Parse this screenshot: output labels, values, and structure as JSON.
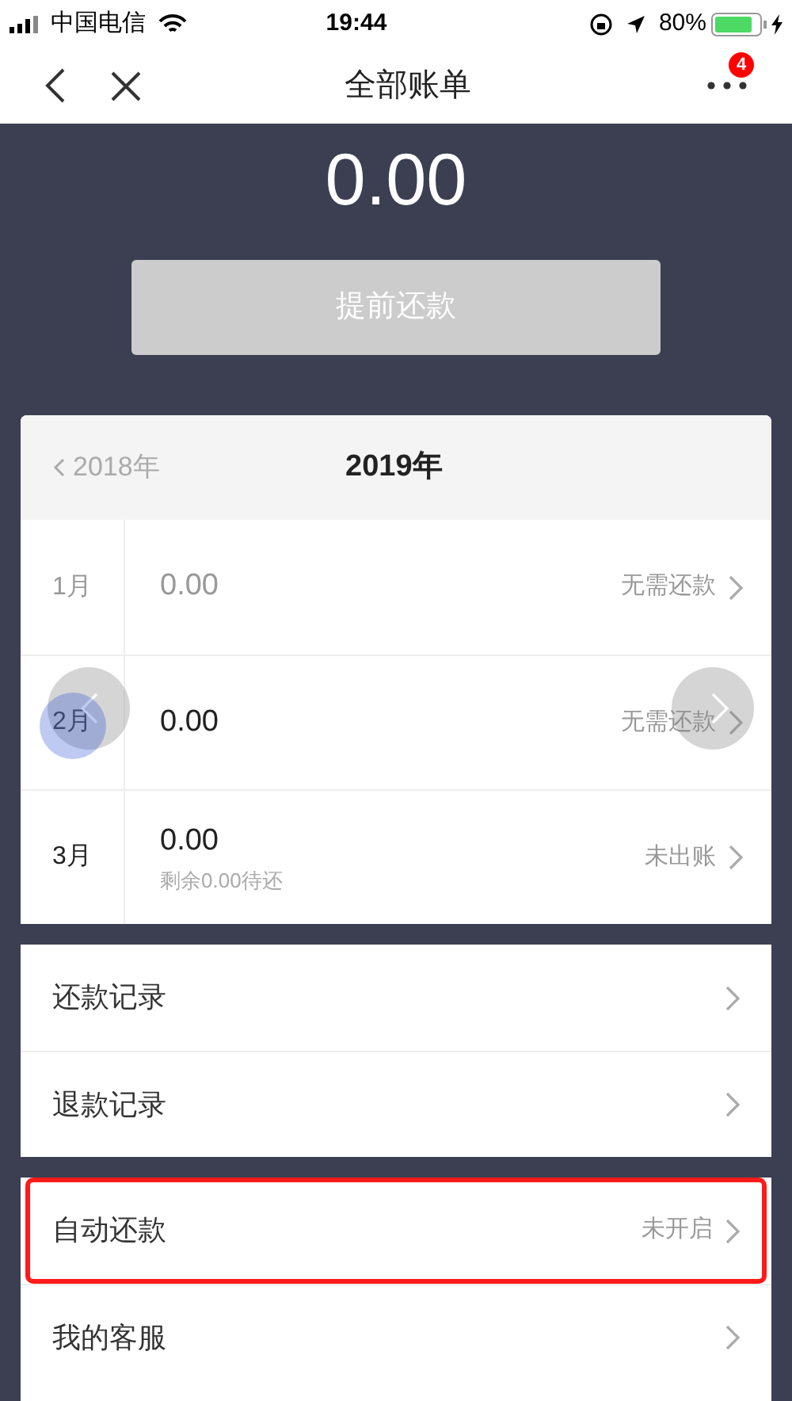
{
  "status_bar": {
    "carrier": "中国电信",
    "time": "19:44",
    "battery": "80%"
  },
  "nav": {
    "title": "全部账单",
    "badge": "4"
  },
  "amount": "0.00",
  "prepay_button": {
    "label": "提前还款",
    "disabled": true
  },
  "year_header": {
    "previous": "2018年",
    "current": "2019年"
  },
  "months": [
    {
      "month": "1月",
      "amount": "0.00",
      "status": "无需还款",
      "muted": true
    },
    {
      "month": "2月",
      "amount": "0.00",
      "status": "无需还款",
      "muted": false
    },
    {
      "month": "3月",
      "amount": "0.00",
      "note": "剩余0.00待还",
      "status": "未出账",
      "muted": false
    }
  ],
  "records": [
    {
      "label": "还款记录"
    },
    {
      "label": "退款记录"
    }
  ],
  "settings": [
    {
      "label": "自动还款",
      "value": "未开启",
      "highlighted": true
    },
    {
      "label": "我的客服",
      "highlighted": false
    }
  ]
}
